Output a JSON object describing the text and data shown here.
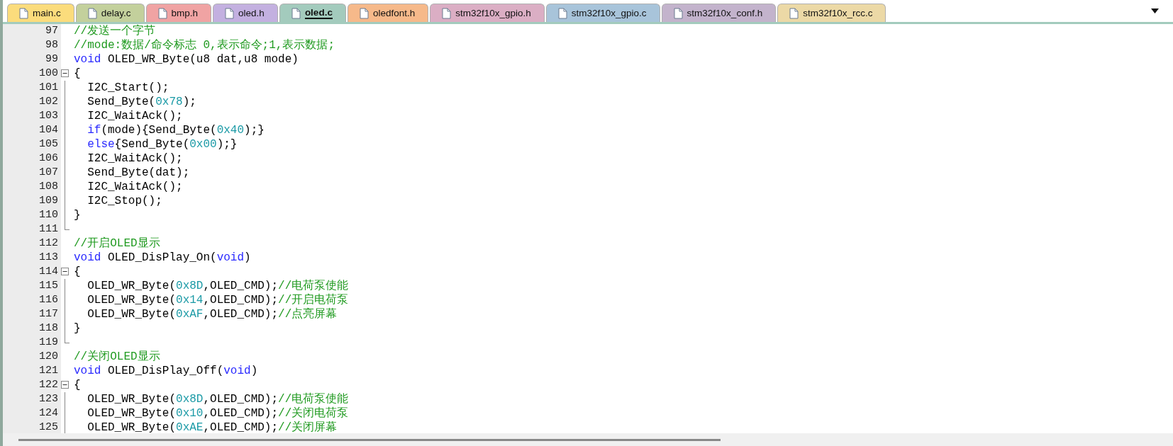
{
  "tabs": [
    {
      "label": "main.c",
      "selected": false,
      "color": "#fbdc7c"
    },
    {
      "label": "delay.c",
      "selected": false,
      "color": "#c3d09c"
    },
    {
      "label": "bmp.h",
      "selected": false,
      "color": "#f0a3a3"
    },
    {
      "label": "oled.h",
      "selected": false,
      "color": "#c3b0e0"
    },
    {
      "label": "oled.c",
      "selected": true,
      "color": "#a3cbbd"
    },
    {
      "label": "oledfont.h",
      "selected": false,
      "color": "#f6b98a"
    },
    {
      "label": "stm32f10x_gpio.h",
      "selected": false,
      "color": "#dbaec4"
    },
    {
      "label": "stm32f10x_gpio.c",
      "selected": false,
      "color": "#a8c4da"
    },
    {
      "label": "stm32f10x_conf.h",
      "selected": false,
      "color": "#c3b3cc"
    },
    {
      "label": "stm32f10x_rcc.c",
      "selected": false,
      "color": "#ecd9a6"
    }
  ],
  "editor": {
    "lines": [
      {
        "number": "97",
        "kind": "plain",
        "tokens": [
          {
            "kind": "cmt",
            "text": "//发送一个字节"
          }
        ]
      },
      {
        "number": "98",
        "kind": "plain",
        "tokens": [
          {
            "kind": "cmt",
            "text": "//mode:数据/命令标志 0,表示命令;1,表示数据;"
          }
        ]
      },
      {
        "number": "99",
        "kind": "plain",
        "tokens": [
          {
            "kind": "kw",
            "text": "void"
          },
          {
            "kind": "plain",
            "text": " OLED_WR_Byte(u8 dat,u8 mode)"
          }
        ]
      },
      {
        "number": "100",
        "kind": "open",
        "tokens": [
          {
            "kind": "plain",
            "text": "{"
          }
        ]
      },
      {
        "number": "101",
        "kind": "body",
        "tokens": [
          {
            "kind": "plain",
            "text": "  I2C_Start();"
          }
        ]
      },
      {
        "number": "102",
        "kind": "body",
        "tokens": [
          {
            "kind": "plain",
            "text": "  Send_Byte("
          },
          {
            "kind": "num",
            "text": "0x78"
          },
          {
            "kind": "plain",
            "text": ");"
          }
        ]
      },
      {
        "number": "103",
        "kind": "body",
        "tokens": [
          {
            "kind": "plain",
            "text": "  I2C_WaitAck();"
          }
        ]
      },
      {
        "number": "104",
        "kind": "body",
        "tokens": [
          {
            "kind": "kw",
            "text": "  if"
          },
          {
            "kind": "plain",
            "text": "(mode){Send_Byte("
          },
          {
            "kind": "num",
            "text": "0x40"
          },
          {
            "kind": "plain",
            "text": ");}"
          }
        ]
      },
      {
        "number": "105",
        "kind": "body",
        "tokens": [
          {
            "kind": "kw",
            "text": "  else"
          },
          {
            "kind": "plain",
            "text": "{Send_Byte("
          },
          {
            "kind": "num",
            "text": "0x00"
          },
          {
            "kind": "plain",
            "text": ");}"
          }
        ]
      },
      {
        "number": "106",
        "kind": "body",
        "tokens": [
          {
            "kind": "plain",
            "text": "  I2C_WaitAck();"
          }
        ]
      },
      {
        "number": "107",
        "kind": "body",
        "tokens": [
          {
            "kind": "plain",
            "text": "  Send_Byte(dat);"
          }
        ]
      },
      {
        "number": "108",
        "kind": "body",
        "tokens": [
          {
            "kind": "plain",
            "text": "  I2C_WaitAck();"
          }
        ]
      },
      {
        "number": "109",
        "kind": "body",
        "tokens": [
          {
            "kind": "plain",
            "text": "  I2C_Stop();"
          }
        ]
      },
      {
        "number": "110",
        "kind": "body",
        "tokens": [
          {
            "kind": "plain",
            "text": "}"
          }
        ]
      },
      {
        "number": "111",
        "kind": "end"
      },
      {
        "number": "112",
        "kind": "plain",
        "tokens": [
          {
            "kind": "cmt",
            "text": "//开启OLED显示"
          }
        ]
      },
      {
        "number": "113",
        "kind": "plain",
        "tokens": [
          {
            "kind": "kw",
            "text": "void"
          },
          {
            "kind": "plain",
            "text": " OLED_DisPlay_On("
          },
          {
            "kind": "kw",
            "text": "void"
          },
          {
            "kind": "plain",
            "text": ")"
          }
        ]
      },
      {
        "number": "114",
        "kind": "open",
        "tokens": [
          {
            "kind": "plain",
            "text": "{"
          }
        ]
      },
      {
        "number": "115",
        "kind": "body",
        "tokens": [
          {
            "kind": "plain",
            "text": "  OLED_WR_Byte("
          },
          {
            "kind": "num",
            "text": "0x8D"
          },
          {
            "kind": "plain",
            "text": ",OLED_CMD);"
          },
          {
            "kind": "cmt",
            "text": "//电荷泵使能"
          }
        ]
      },
      {
        "number": "116",
        "kind": "body",
        "tokens": [
          {
            "kind": "plain",
            "text": "  OLED_WR_Byte("
          },
          {
            "kind": "num",
            "text": "0x14"
          },
          {
            "kind": "plain",
            "text": ",OLED_CMD);"
          },
          {
            "kind": "cmt",
            "text": "//开启电荷泵"
          }
        ]
      },
      {
        "number": "117",
        "kind": "body",
        "tokens": [
          {
            "kind": "plain",
            "text": "  OLED_WR_Byte("
          },
          {
            "kind": "num",
            "text": "0xAF"
          },
          {
            "kind": "plain",
            "text": ",OLED_CMD);"
          },
          {
            "kind": "cmt",
            "text": "//点亮屏幕"
          }
        ]
      },
      {
        "number": "118",
        "kind": "body",
        "tokens": [
          {
            "kind": "plain",
            "text": "}"
          }
        ]
      },
      {
        "number": "119",
        "kind": "end"
      },
      {
        "number": "120",
        "kind": "plain",
        "tokens": [
          {
            "kind": "cmt",
            "text": "//关闭OLED显示"
          }
        ]
      },
      {
        "number": "121",
        "kind": "plain",
        "tokens": [
          {
            "kind": "kw",
            "text": "void"
          },
          {
            "kind": "plain",
            "text": " OLED_DisPlay_Off("
          },
          {
            "kind": "kw",
            "text": "void"
          },
          {
            "kind": "plain",
            "text": ")"
          }
        ]
      },
      {
        "number": "122",
        "kind": "open",
        "tokens": [
          {
            "kind": "plain",
            "text": "{"
          }
        ]
      },
      {
        "number": "123",
        "kind": "body",
        "tokens": [
          {
            "kind": "plain",
            "text": "  OLED_WR_Byte("
          },
          {
            "kind": "num",
            "text": "0x8D"
          },
          {
            "kind": "plain",
            "text": ",OLED_CMD);"
          },
          {
            "kind": "cmt",
            "text": "//电荷泵使能"
          }
        ]
      },
      {
        "number": "124",
        "kind": "body",
        "tokens": [
          {
            "kind": "plain",
            "text": "  OLED_WR_Byte("
          },
          {
            "kind": "num",
            "text": "0x10"
          },
          {
            "kind": "plain",
            "text": ",OLED_CMD);"
          },
          {
            "kind": "cmt",
            "text": "//关闭电荷泵"
          }
        ]
      },
      {
        "number": "125",
        "kind": "body",
        "tokens": [
          {
            "kind": "plain",
            "text": "  OLED_WR_Byte("
          },
          {
            "kind": "num",
            "text": "0xAE"
          },
          {
            "kind": "plain",
            "text": ",OLED_CMD);"
          },
          {
            "kind": "cmt",
            "text": "//关闭屏幕"
          }
        ]
      }
    ]
  }
}
